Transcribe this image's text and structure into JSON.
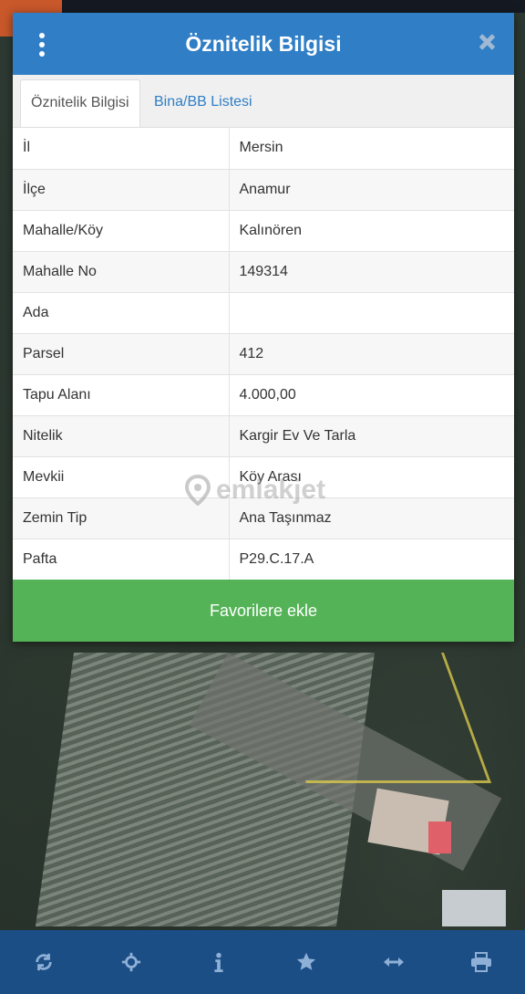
{
  "modal": {
    "title": "Öznitelik Bilgisi",
    "tabs": [
      {
        "label": "Öznitelik Bilgisi",
        "active": true
      },
      {
        "label": "Bina/BB Listesi",
        "active": false
      }
    ],
    "rows": [
      {
        "key": "İl",
        "value": "Mersin"
      },
      {
        "key": "İlçe",
        "value": "Anamur"
      },
      {
        "key": "Mahalle/Köy",
        "value": "Kalınören"
      },
      {
        "key": "Mahalle No",
        "value": "149314"
      },
      {
        "key": "Ada",
        "value": ""
      },
      {
        "key": "Parsel",
        "value": "412"
      },
      {
        "key": "Tapu Alanı",
        "value": "4.000,00"
      },
      {
        "key": "Nitelik",
        "value": "Kargir Ev Ve Tarla"
      },
      {
        "key": "Mevkii",
        "value": "Köy Arası"
      },
      {
        "key": "Zemin Tip",
        "value": "Ana Taşınmaz"
      },
      {
        "key": "Pafta",
        "value": "P29.C.17.A"
      }
    ],
    "favorite_button": "Favorilere ekle"
  },
  "watermark": "emlakjet",
  "toolbar": {
    "icons": [
      "refresh-icon",
      "locate-icon",
      "info-icon",
      "star-icon",
      "measure-icon",
      "print-icon"
    ]
  },
  "colors": {
    "header": "#2f7ec6",
    "button": "#55b357",
    "toolbar": "#1c4e86"
  }
}
